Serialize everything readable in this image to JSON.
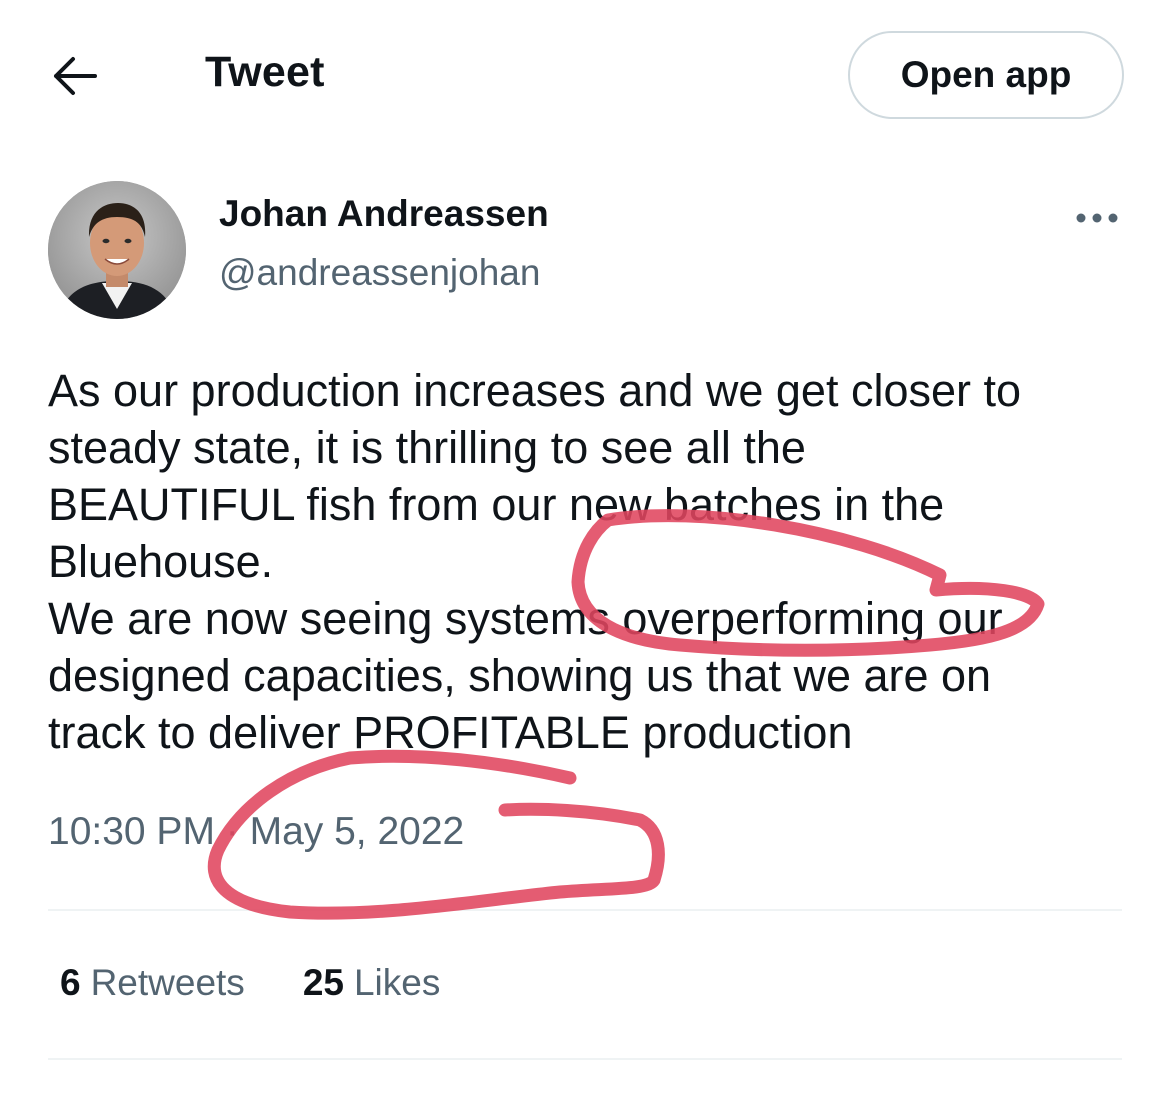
{
  "header": {
    "back_icon": "arrow-left-icon",
    "title": "Tweet",
    "open_app_label": "Open app"
  },
  "author": {
    "name": "Johan Andreassen",
    "handle": "@andreassenjohan",
    "more_icon": "ellipsis-icon"
  },
  "tweet": {
    "lines": [
      "As our production increases and we get closer to",
      "steady state, it is thrilling to see all the",
      "BEAUTIFUL fish from our new batches  in the",
      "Bluehouse.",
      "We are now seeing systems overperforming our",
      "designed capacities, showing us that we are on",
      "track to deliver PROFITABLE production"
    ],
    "timestamp": "10:30 PM · May 5, 2022"
  },
  "stats": {
    "retweets_count": "6",
    "retweets_label": "Retweets",
    "likes_count": "25",
    "likes_label": "Likes"
  },
  "colors": {
    "text_primary": "#0f1419",
    "text_secondary": "#536471",
    "annotation_marker": "#e0455e"
  }
}
